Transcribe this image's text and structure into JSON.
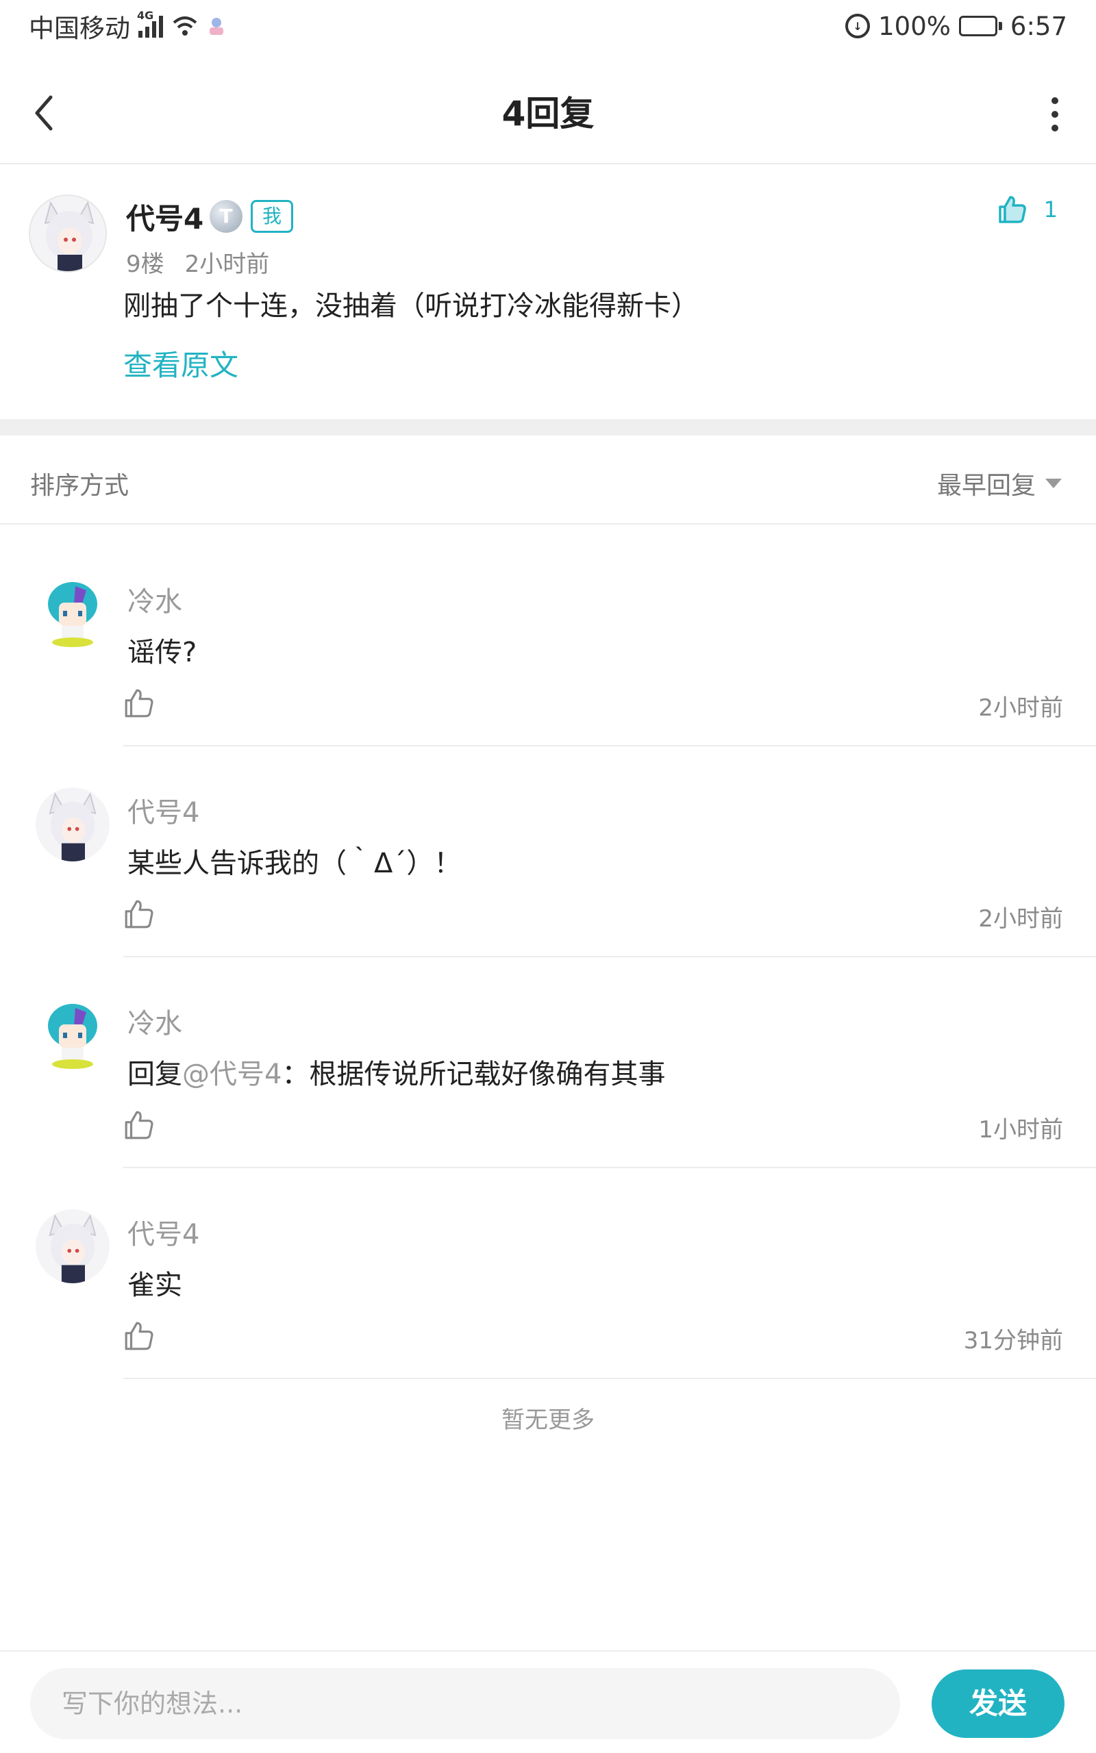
{
  "status_bar": {
    "carrier": "中国移动",
    "network": "4G",
    "battery_percent": "100%",
    "time": "6:57"
  },
  "header": {
    "title": "4回复"
  },
  "post": {
    "author": "代号4",
    "level_badge": "T",
    "me_tag": "我",
    "floor": "9楼",
    "time": "2小时前",
    "content": "刚抽了个十连，没抽着（听说打冷冰能得新卡）",
    "view_original": "查看原文",
    "like_count": "1"
  },
  "sort": {
    "label": "排序方式",
    "selected": "最早回复"
  },
  "replies": [
    {
      "author": "冷水",
      "reply_prefix": "",
      "mention": "",
      "text": "谣传?",
      "time": "2小时前",
      "avatar": "cyan-hair-avatar"
    },
    {
      "author": "代号4",
      "reply_prefix": "",
      "mention": "",
      "text": "某些人告诉我的（｀Δ´）！",
      "time": "2小时前",
      "avatar": "fox-girl-avatar"
    },
    {
      "author": "冷水",
      "reply_prefix": "回复",
      "mention": "@代号4",
      "text": "：根据传说所记载好像确有其事",
      "time": "1小时前",
      "avatar": "cyan-hair-avatar"
    },
    {
      "author": "代号4",
      "reply_prefix": "",
      "mention": "",
      "text": "雀实",
      "time": "31分钟前",
      "avatar": "fox-girl-avatar"
    }
  ],
  "footer_note": "暂无更多",
  "compose": {
    "placeholder": "写下你的想法...",
    "send_label": "发送"
  },
  "colors": {
    "accent": "#22b3c3",
    "divider": "#efefef",
    "muted_text": "#8a8a8a"
  }
}
